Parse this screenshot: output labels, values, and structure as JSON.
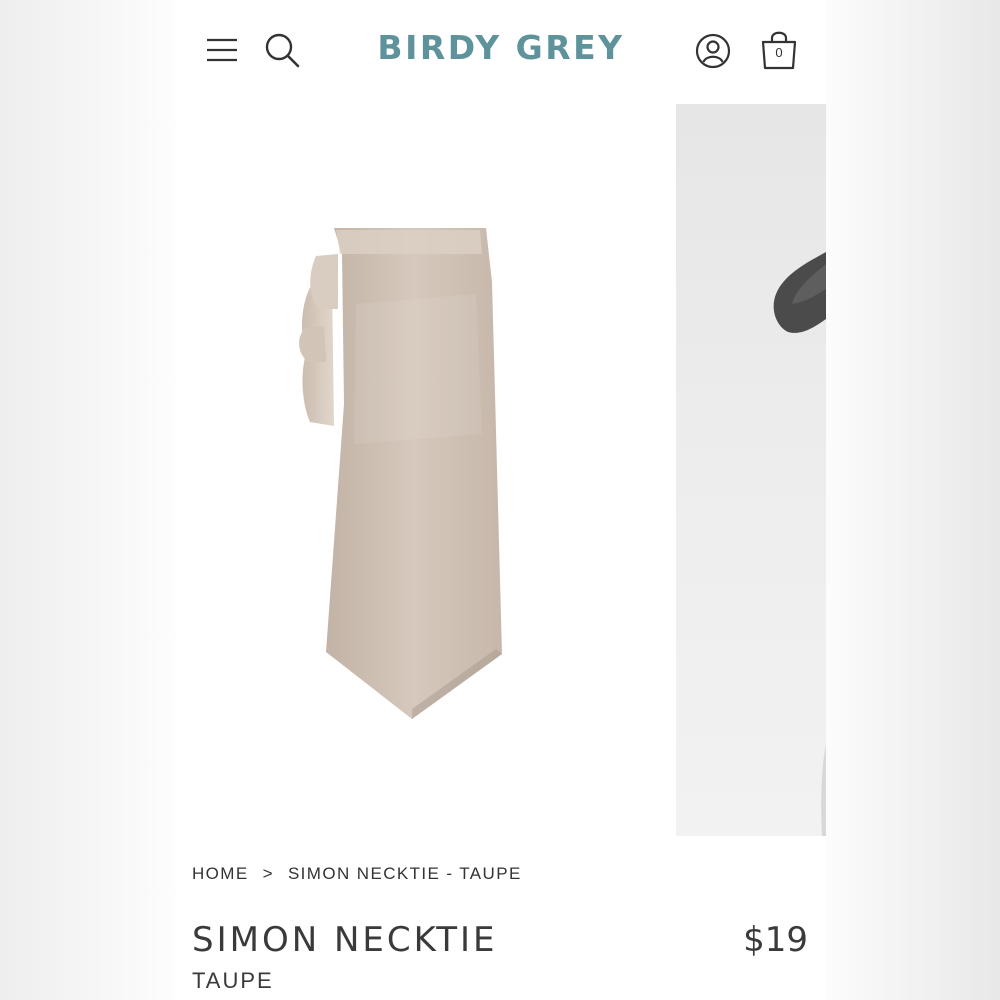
{
  "header": {
    "brand": "BIRDY GREY",
    "brand_color": "#5e939b",
    "icons": [
      "hamburger-menu-icon",
      "search-icon",
      "account-icon",
      "shopping-bag-icon"
    ],
    "cart_count": "0"
  },
  "gallery": {
    "main_image": "taupe-necktie",
    "next_image": "model-wearing-tie"
  },
  "breadcrumb": {
    "home": "HOME",
    "separator": ">",
    "current": "SIMON NECKTIE - TAUPE"
  },
  "product": {
    "name": "SIMON NECKTIE",
    "color": "TAUPE",
    "price": "$19"
  }
}
